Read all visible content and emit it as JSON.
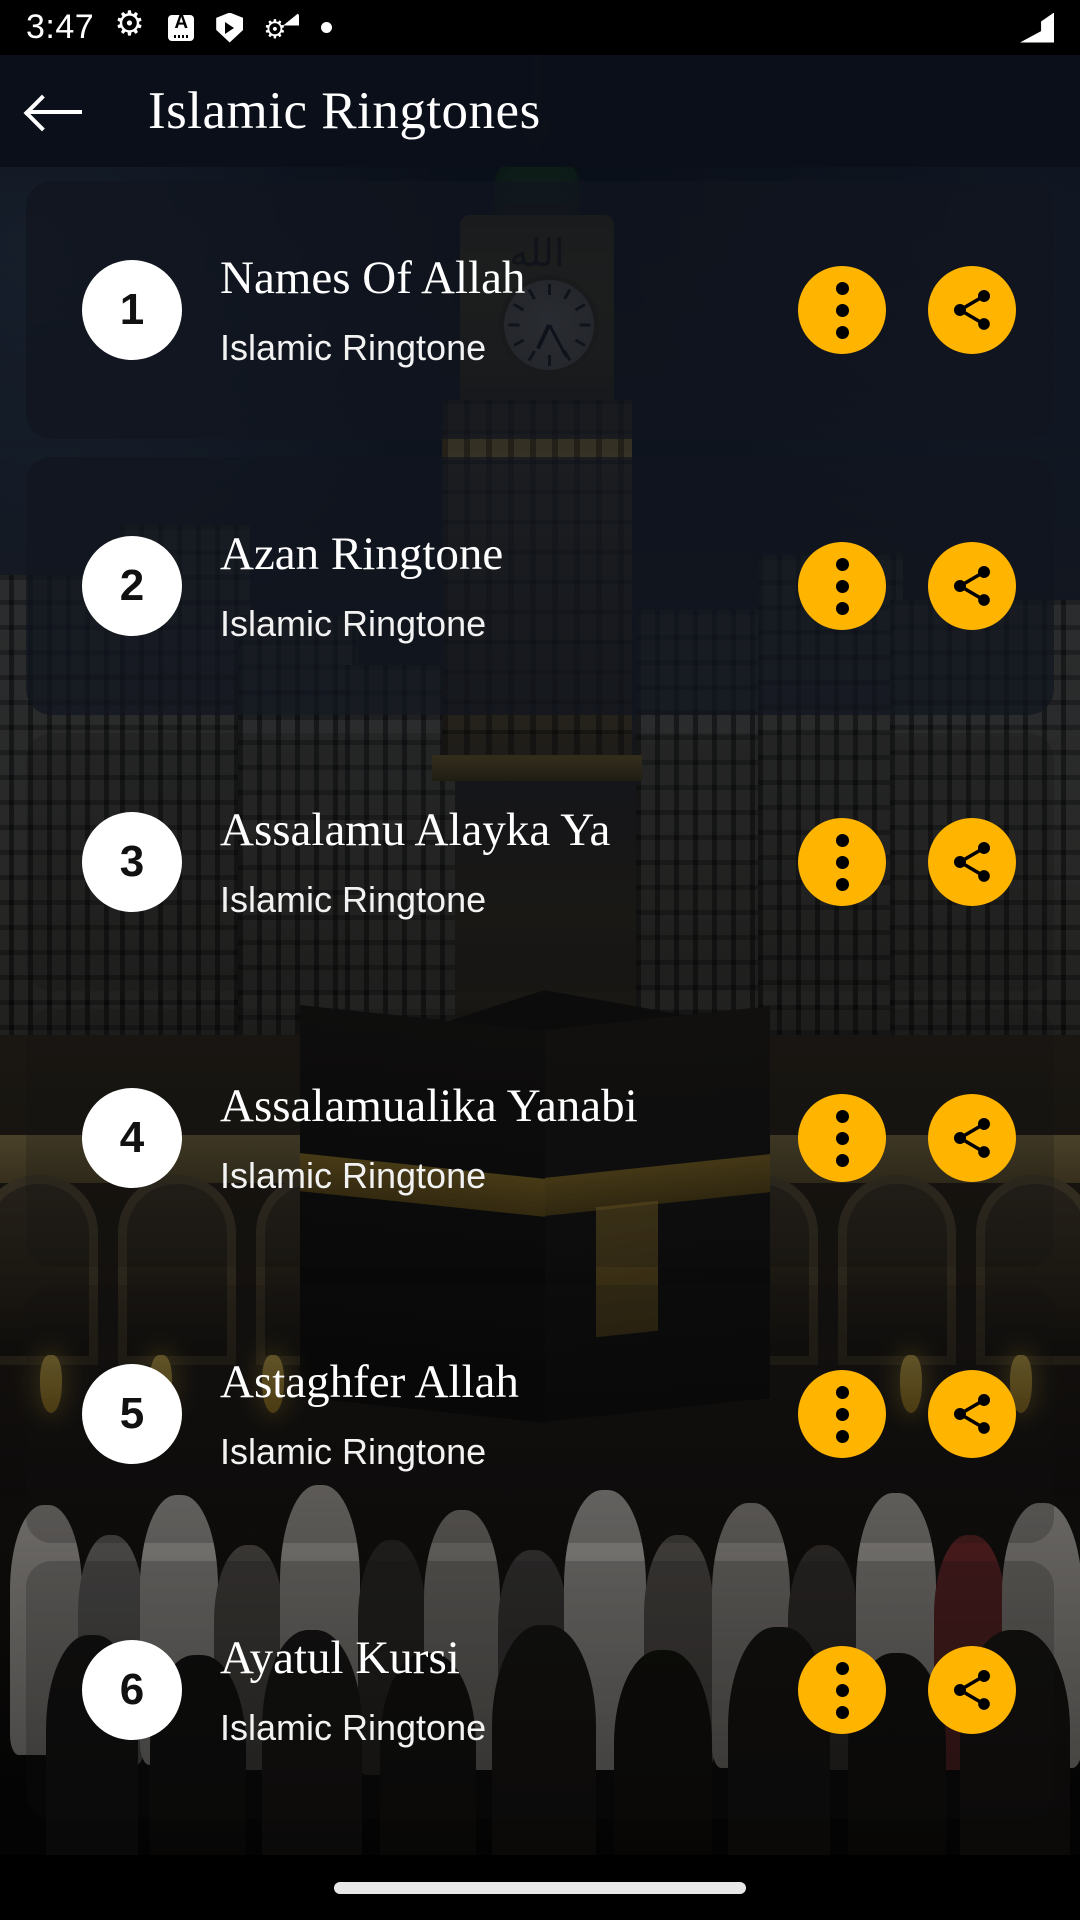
{
  "status_bar": {
    "time": "3:47",
    "icons": [
      "gear-icon",
      "a-subtitles-icon",
      "shield-play-icon",
      "gear-wifi-icon",
      "dot-icon"
    ],
    "right_icons": [
      "signal-strength-icon"
    ]
  },
  "app_bar": {
    "back_icon": "arrow-left-icon",
    "title": "Islamic Ringtones"
  },
  "list": {
    "subtitle_common": "Islamic Ringtone",
    "menu_icon": "more-vertical-icon",
    "share_icon": "share-icon",
    "items": [
      {
        "number": "1",
        "title": "Names Of Allah",
        "subtitle": "Islamic Ringtone"
      },
      {
        "number": "2",
        "title": "Azan Ringtone",
        "subtitle": "Islamic Ringtone"
      },
      {
        "number": "3",
        "title": "Assalamu Alayka Ya",
        "subtitle": "Islamic Ringtone"
      },
      {
        "number": "4",
        "title": "Assalamualika Yanabi",
        "subtitle": "Islamic Ringtone"
      },
      {
        "number": "5",
        "title": "Astaghfer Allah",
        "subtitle": "Islamic Ringtone"
      },
      {
        "number": "6",
        "title": "Ayatul Kursi",
        "subtitle": "Islamic Ringtone"
      }
    ]
  },
  "nav_bar": {
    "handle": "gesture-home-pill"
  },
  "colors": {
    "accent": "#ffb400",
    "app_bar_bg": "#0b101a",
    "badge_bg": "#ffffff",
    "text_primary": "#ffffff",
    "status_bar_bg": "#000000"
  },
  "background": {
    "description": "Masjid al-Haram Mecca with Abraj Al Bait clock tower and Kaaba"
  }
}
